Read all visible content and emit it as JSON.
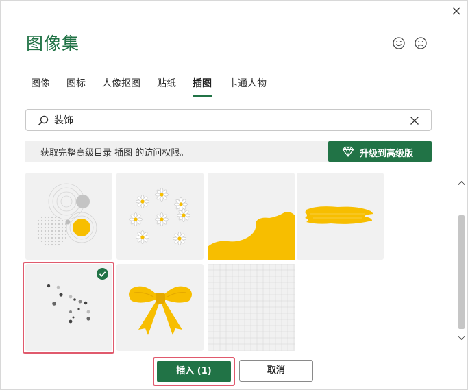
{
  "dialog": {
    "title": "图像集"
  },
  "feedback": {
    "like_icon": "smile-icon",
    "dislike_icon": "frown-icon"
  },
  "tabs": [
    {
      "label": "图像"
    },
    {
      "label": "图标"
    },
    {
      "label": "人像抠图"
    },
    {
      "label": "贴纸"
    },
    {
      "label": "插图",
      "active": true
    },
    {
      "label": "卡通人物"
    }
  ],
  "search": {
    "value": "装饰",
    "placeholder": ""
  },
  "banner": {
    "text": "获取完整高级目录 插图 的访问权限。",
    "upgrade_label": "升级到高级版"
  },
  "gallery": {
    "items": [
      {
        "name": "circles-dots-illustration"
      },
      {
        "name": "daisies-illustration"
      },
      {
        "name": "yellow-wave-illustration"
      },
      {
        "name": "yellow-brush-stroke-illustration"
      },
      {
        "name": "scattered-dots-illustration",
        "selected": true
      },
      {
        "name": "yellow-bow-illustration"
      },
      {
        "name": "grid-paper-illustration"
      }
    ]
  },
  "footer": {
    "insert_label": "插入 (1)",
    "cancel_label": "取消"
  },
  "colors": {
    "accent": "#217346",
    "highlight": "#e05a6d",
    "yellow": "#f7be00",
    "tile_bg": "#f1f1f1"
  }
}
